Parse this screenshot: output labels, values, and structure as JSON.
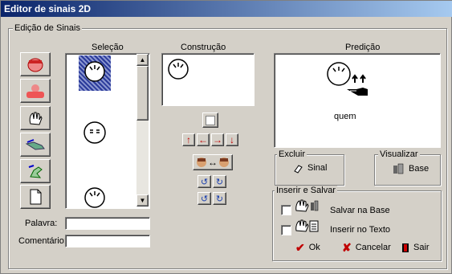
{
  "window": {
    "title": "Editor de sinais 2D"
  },
  "main_group": {
    "label": "Edição de Sinais"
  },
  "selecao": {
    "label": "Seleção"
  },
  "construcao": {
    "label": "Construção"
  },
  "predicao": {
    "label": "Predição",
    "caption": "quem"
  },
  "palavra": {
    "label": "Palavra:",
    "value": ""
  },
  "comentario": {
    "label": "Comentário:",
    "value": ""
  },
  "excluir": {
    "label": "Excluir",
    "button": "Sinal"
  },
  "visualizar": {
    "label": "Visualizar",
    "button": "Base"
  },
  "inserir_salvar": {
    "label": "Inserir e Salvar",
    "salvar_base": "Salvar na Base",
    "inserir_texto": "Inserir no Texto",
    "ok": "Ok",
    "cancelar": "Cancelar",
    "sair": "Sair"
  },
  "arrows": {
    "up": "↑",
    "left": "←",
    "right": "→",
    "down": "↓",
    "swap": "↔"
  },
  "rotate": {
    "cw": "↻",
    "ccw": "↺"
  },
  "colors": {
    "titlebar_start": "#0a246a",
    "titlebar_end": "#a6caf0",
    "face": "#d4d0c8",
    "arrow": "#c00000",
    "ok_check": "#c00000"
  }
}
